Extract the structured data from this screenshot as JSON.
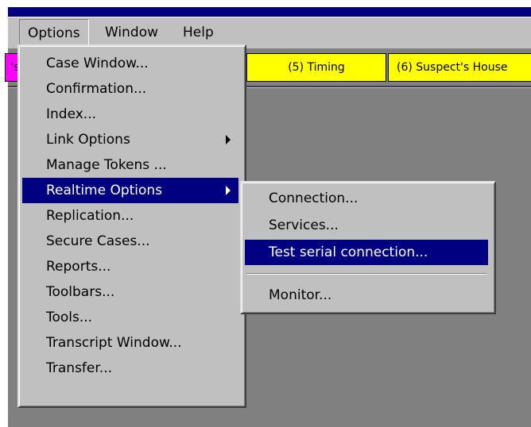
{
  "menubar": {
    "items": [
      "Options",
      "Window",
      "Help"
    ]
  },
  "tabs": [
    {
      "label": "'s",
      "color": "#ff00ff"
    },
    {
      "label": "(5) Timing",
      "color": "#ffff00"
    },
    {
      "label": "(6) Suspect's House",
      "color": "#ffff00"
    }
  ],
  "options_menu": {
    "items": [
      "Case Window...",
      "Confirmation...",
      "Index...",
      "Link Options",
      "Manage Tokens ...",
      "Realtime Options",
      "Replication...",
      "Secure Cases...",
      "Reports...",
      "Toolbars...",
      "Tools...",
      "Transcript Window...",
      "Transfer..."
    ],
    "highlighted": "Realtime Options"
  },
  "realtime_submenu": {
    "items": [
      "Connection...",
      "Services...",
      "Test serial connection...",
      "Monitor..."
    ],
    "highlighted": "Test serial connection..."
  },
  "colors": {
    "titlebar": "#000080",
    "highlight": "#000080",
    "menu_face": "#c0c0c0",
    "client": "#808080"
  }
}
